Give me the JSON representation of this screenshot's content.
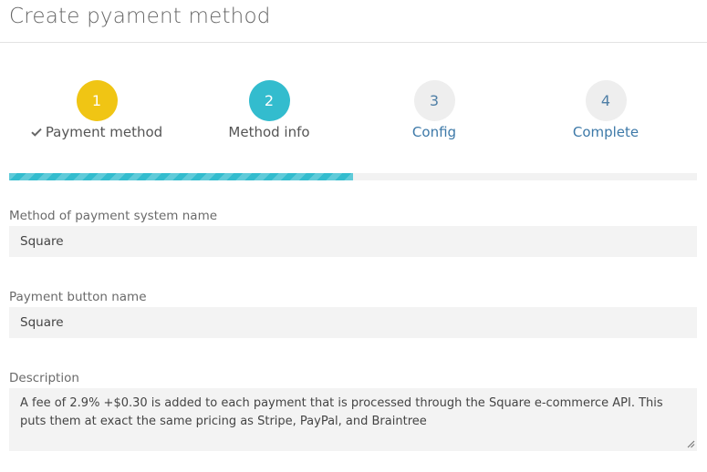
{
  "page": {
    "title": "Create pyament method"
  },
  "stepper": {
    "steps": [
      {
        "number": "1",
        "label": "Payment method",
        "state": "done"
      },
      {
        "number": "2",
        "label": "Method info",
        "state": "active"
      },
      {
        "number": "3",
        "label": "Config",
        "state": "todo"
      },
      {
        "number": "4",
        "label": "Complete",
        "state": "todo"
      }
    ],
    "progress_fraction": 0.5
  },
  "form": {
    "method_name": {
      "label": "Method of payment system name",
      "value": "Square"
    },
    "button_name": {
      "label": "Payment button name",
      "value": "Square"
    },
    "description": {
      "label": "Description",
      "value": "A fee of 2.9% +$0.30 is added to each payment that is processed through the Square e-commerce API. This puts them at exact the same pricing as Stripe, PayPal, and Braintree"
    }
  },
  "colors": {
    "step_done": "#f0c514",
    "step_active": "#33bcce",
    "step_todo_bg": "#eeeeee",
    "step_todo_text": "#3d79a8",
    "input_bg": "#f3f3f3"
  },
  "icons": {
    "done_marker": "check-icon",
    "textarea_resize": "resize-grip-icon"
  }
}
